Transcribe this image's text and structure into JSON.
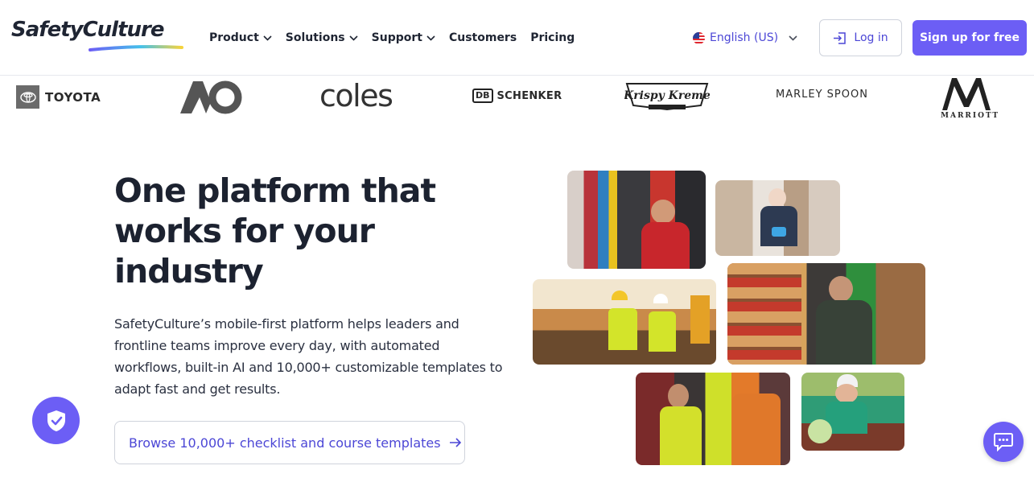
{
  "brand": {
    "name": "SafetyCulture",
    "accent": "#6c5ef5",
    "link": "#4c47d6"
  },
  "nav": {
    "items": [
      {
        "label": "Product",
        "dropdown": true
      },
      {
        "label": "Solutions",
        "dropdown": true
      },
      {
        "label": "Support",
        "dropdown": true
      },
      {
        "label": "Customers",
        "dropdown": false
      },
      {
        "label": "Pricing",
        "dropdown": false
      }
    ],
    "language": "English (US)",
    "login_label": "Log in",
    "signup_label": "Sign up for free"
  },
  "customer_logos": {
    "toyota": "TOYOTA",
    "coles": "coles",
    "db_mark": "DB",
    "db_schenker": "SCHENKER",
    "krispy_kreme": "Krispy Kreme",
    "marley_spoon": "MARLEY SPOON",
    "marriott": "MARRIOTT"
  },
  "hero": {
    "title": "One platform that works for your industry",
    "body": "SafetyCulture’s mobile-first platform helps leaders and frontline teams improve every day, with automated workflows, built-in AI and 10,000+ customizable templates to adapt fast and get results.",
    "cta_label": "Browse 10,000+ checklist and course templates"
  },
  "icons": {
    "nav_chevron": "chevron-down-icon",
    "login": "login-arrow-icon",
    "cta": "arrow-right-icon",
    "shield_fab": "shield-check-icon",
    "chat_fab": "chat-bubble-icon"
  }
}
